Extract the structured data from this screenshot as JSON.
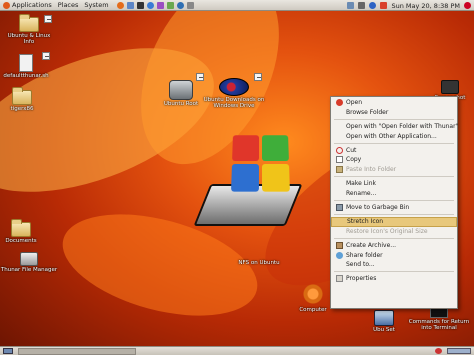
{
  "top_panel": {
    "menus": [
      "Applications",
      "Places",
      "System"
    ],
    "clock": "Sun May 20,  8:38 PM"
  },
  "desktop_icons": [
    {
      "name": "ubuntu-linux-info",
      "label": "Ubuntu & Linux Info",
      "icon": "folder-icon"
    },
    {
      "name": "default-thunar",
      "label": "defaultthunar.sh",
      "icon": "script-icon"
    },
    {
      "name": "tiger-x86",
      "label": "tigerx86",
      "icon": "folder-icon"
    },
    {
      "name": "ubuntu-root",
      "label": "Ubuntu Root",
      "icon": "harddrive-icon"
    },
    {
      "name": "ubuntu-downloads",
      "label": "Ubuntu Downloads on Windows Drive",
      "icon": "disc-icon"
    },
    {
      "name": "nfs-ubuntu",
      "label": "NFS on Ubuntu",
      "icon": "windows-drive-icon"
    },
    {
      "name": "documents",
      "label": "Documents",
      "icon": "folder-icon"
    },
    {
      "name": "thunar-file-manager",
      "label": "Thunar File Manager",
      "icon": "file-manager-icon"
    },
    {
      "name": "computer",
      "label": "Computer",
      "icon": "computer-icon"
    },
    {
      "name": "ubuntu-set",
      "label": "Ubu Set",
      "icon": "network-icon"
    },
    {
      "name": "commands-terminal",
      "label": "Commands for Return into Terminal",
      "icon": "terminal-icon"
    },
    {
      "name": "screenshot",
      "label": "Screenshot",
      "icon": "camera-icon"
    }
  ],
  "context_menu": {
    "items": [
      {
        "label": "Open",
        "icon": "open-icon",
        "state": "normal"
      },
      {
        "label": "Browse Folder",
        "icon": "",
        "state": "normal"
      },
      {
        "sep": true
      },
      {
        "label": "Open with \"Open Folder with Thunar\"",
        "icon": "",
        "state": "normal"
      },
      {
        "label": "Open with Other Application...",
        "icon": "",
        "state": "normal"
      },
      {
        "sep": true
      },
      {
        "label": "Cut",
        "icon": "cut-icon",
        "state": "normal"
      },
      {
        "label": "Copy",
        "icon": "copy-icon",
        "state": "normal"
      },
      {
        "label": "Paste Into Folder",
        "icon": "paste-icon",
        "state": "disabled"
      },
      {
        "sep": true
      },
      {
        "label": "Make Link",
        "icon": "",
        "state": "normal"
      },
      {
        "label": "Rename...",
        "icon": "",
        "state": "normal"
      },
      {
        "sep": true
      },
      {
        "label": "Move to Garbage Bin",
        "icon": "trash-icon",
        "state": "normal"
      },
      {
        "sep": true
      },
      {
        "label": "Stretch Icon",
        "icon": "",
        "state": "hover"
      },
      {
        "label": "Restore Icon's Original Size",
        "icon": "",
        "state": "disabled"
      },
      {
        "sep": true
      },
      {
        "label": "Create Archive...",
        "icon": "archive-icon",
        "state": "normal"
      },
      {
        "label": "Share folder",
        "icon": "share-icon",
        "state": "normal"
      },
      {
        "label": "Send to...",
        "icon": "",
        "state": "normal"
      },
      {
        "sep": true
      },
      {
        "label": "Properties",
        "icon": "properties-icon",
        "state": "normal"
      }
    ]
  },
  "colors": {
    "windows_red": "#e0362a",
    "windows_green": "#3fae3a",
    "windows_blue": "#2d6fd0",
    "windows_yellow": "#f0c419",
    "menu_hover": "#e8c87c"
  }
}
